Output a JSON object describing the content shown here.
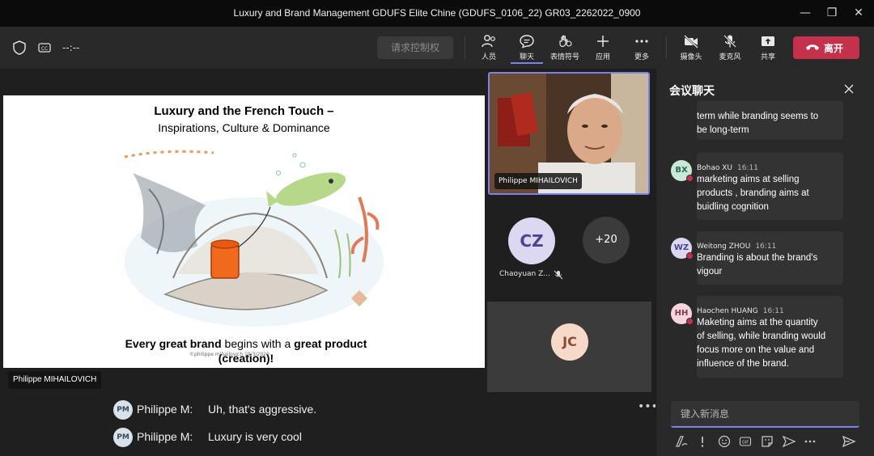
{
  "window": {
    "title": "Luxury and Brand Management GDUFS Elite Chine (GDUFS_0106_22) GR03_2262022_0900",
    "minimize": "—",
    "maximize": "❐",
    "close": "✕"
  },
  "toolbar": {
    "timer": "--:--",
    "request_control": "请求控制权",
    "people": "人员",
    "chat": "聊天",
    "reactions": "表情符号",
    "apps": "应用",
    "more": "更多",
    "camera": "摄像头",
    "mic": "麦克风",
    "share": "共享",
    "leave": "离开",
    "leave_color": "#c4314b",
    "accent": "#7b83eb"
  },
  "slide": {
    "title": "Luxury and the French Touch –",
    "subtitle": "Inspirations, Culture & Dominance",
    "caption_bold1": "Every great brand",
    "caption_mid": " begins with a ",
    "caption_bold2": "great product",
    "caption_line2": "(creation)!",
    "footer_small": "©philippe mihailovich 19/3/2020",
    "presenter": "Philippe MIHAILOVICH"
  },
  "participants": {
    "video_name": "Philippe MIHAILOVICH",
    "cz_initials": "CZ",
    "cz_name": "Chaoyuan Z...",
    "overflow": "+20",
    "jc_initials": "JC"
  },
  "captions": [
    {
      "initials": "PM",
      "speaker": "Philippe M:",
      "text": "Uh, that's aggressive."
    },
    {
      "initials": "PM",
      "speaker": "Philippe M:",
      "text": "Luxury is very cool"
    }
  ],
  "chat": {
    "title": "会议聊天",
    "partial_lines": [
      "term while branding seems to",
      "be long-term"
    ],
    "messages": [
      {
        "initials": "BX",
        "name": "Bohao XU",
        "time": "16:11",
        "lines": [
          "marketing aims at selling",
          "products , branding aims at",
          "buidling cognition"
        ],
        "avatar_bg": "#c9e8d8",
        "avatar_fg": "#2b6b4a"
      },
      {
        "initials": "WZ",
        "name": "Weitong ZHOU",
        "time": "16:11",
        "lines": [
          "Branding is about the brand's",
          "vigour"
        ],
        "avatar_bg": "#dcd8f2",
        "avatar_fg": "#4b4591"
      },
      {
        "initials": "HH",
        "name": "Haochen HUANG",
        "time": "16:11",
        "lines": [
          "Maketing aims at the quantity",
          "of selling, while branding would",
          "focus more on the value and",
          "influence of the brand."
        ],
        "avatar_bg": "#f3d6de",
        "avatar_fg": "#8a3550"
      }
    ],
    "placeholder": "键入新消息"
  }
}
